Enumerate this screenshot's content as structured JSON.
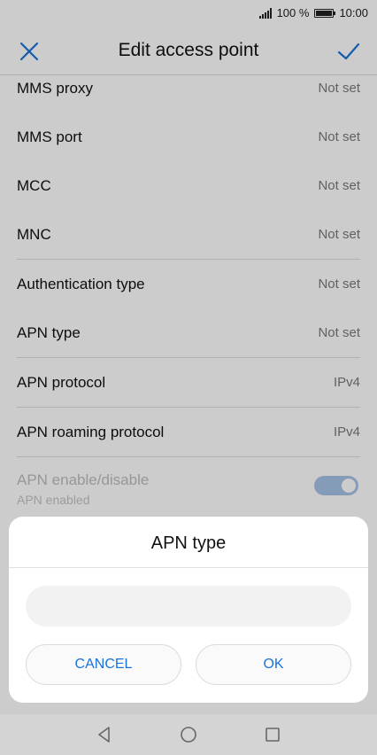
{
  "status": {
    "battery": "100 %",
    "time": "10:00"
  },
  "appbar": {
    "title": "Edit access point"
  },
  "settings": [
    {
      "label": "MMS proxy",
      "value": "Not set"
    },
    {
      "label": "MMS port",
      "value": "Not set"
    },
    {
      "label": "MCC",
      "value": "Not set"
    },
    {
      "label": "MNC",
      "value": "Not set"
    },
    {
      "label": "Authentication type",
      "value": "Not set"
    },
    {
      "label": "APN type",
      "value": "Not set"
    },
    {
      "label": "APN protocol",
      "value": "IPv4"
    },
    {
      "label": "APN roaming protocol",
      "value": "IPv4"
    }
  ],
  "apn_toggle": {
    "label": "APN enable/disable",
    "sublabel": "APN enabled",
    "enabled": true
  },
  "dialog": {
    "title": "APN type",
    "input_value": "",
    "cancel_label": "CANCEL",
    "ok_label": "OK"
  },
  "colors": {
    "accent": "#1a73d9",
    "switch_on": "#a7c3e6"
  }
}
